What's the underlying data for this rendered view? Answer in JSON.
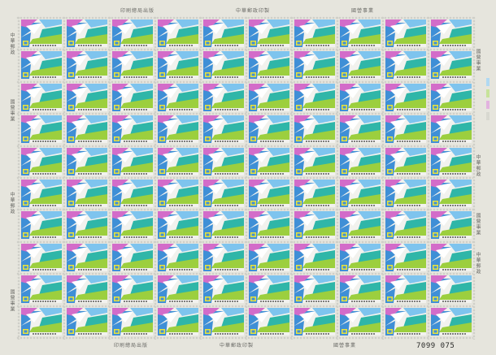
{
  "sheet": {
    "title": "",
    "serial_number": "7099 075",
    "rows": 10,
    "columns": 10,
    "stamp_text": "中華民國郵票"
  },
  "margins": {
    "top": [
      "印刷總局出版",
      "中華郵政印製",
      "國營事業"
    ],
    "bottom": [
      "印刷總局出版",
      "中華郵政印製",
      "國營事業"
    ],
    "left": [
      "中華郵政",
      "國營事業",
      "中華郵政",
      "國營事業"
    ],
    "right": [
      "國營事業",
      "中華郵政",
      "國營事業",
      "中華郵政"
    ]
  },
  "colors": {
    "sheet": "#e6e5dd",
    "stamp_bg": "#f2f2ee",
    "blue": "#3f8fd6",
    "sky_blue": "#7ec4ee",
    "green": "#9ccf3e",
    "teal": "#2fb6a8",
    "magenta": "#d36cc9",
    "white": "#ffffff",
    "logo_yellow": "#e8e23a"
  },
  "color_marks": [
    "#b1d9f2",
    "#c7e39a",
    "#e2b3df",
    "#d8d8d0"
  ]
}
